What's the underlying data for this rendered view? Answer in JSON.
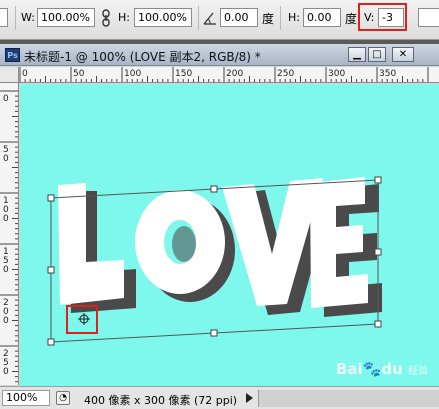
{
  "options_bar": {
    "w_label": "W:",
    "w_value": "100.00%",
    "h_label": "H:",
    "h_value": "100.00%",
    "rotate_value": "0.00",
    "rotate_unit": "度",
    "hskew_label": "H:",
    "hskew_value": "0.00",
    "hskew_unit": "度",
    "vskew_label": "V:",
    "vskew_value": "-3"
  },
  "document": {
    "title": "未标题-1 @ 100% (LOVE 副本2, RGB/8) *",
    "canvas_color": "#7ef7ec",
    "artwork_text": "LOVE",
    "minimize_icon": "minimize-icon",
    "maximize_icon": "maximize-icon",
    "close_icon": "close-icon"
  },
  "ruler": {
    "h_ticks": [
      "0",
      "50",
      "100",
      "150",
      "200",
      "250",
      "300",
      "350"
    ],
    "v_ticks": [
      "0",
      "5 0",
      "1 0 0",
      "1 5 0",
      "2 0 0",
      "2 5 0"
    ]
  },
  "status_bar": {
    "zoom": "100%",
    "doc_info": "400 像素 x 300 像素 (72 ppi)"
  },
  "watermark": {
    "text": "Bai",
    "paw": "🐾",
    "text2": "du",
    "sub": "经验"
  },
  "colors": {
    "highlight": "#e0201c",
    "canvas": "#7ef7ec"
  }
}
